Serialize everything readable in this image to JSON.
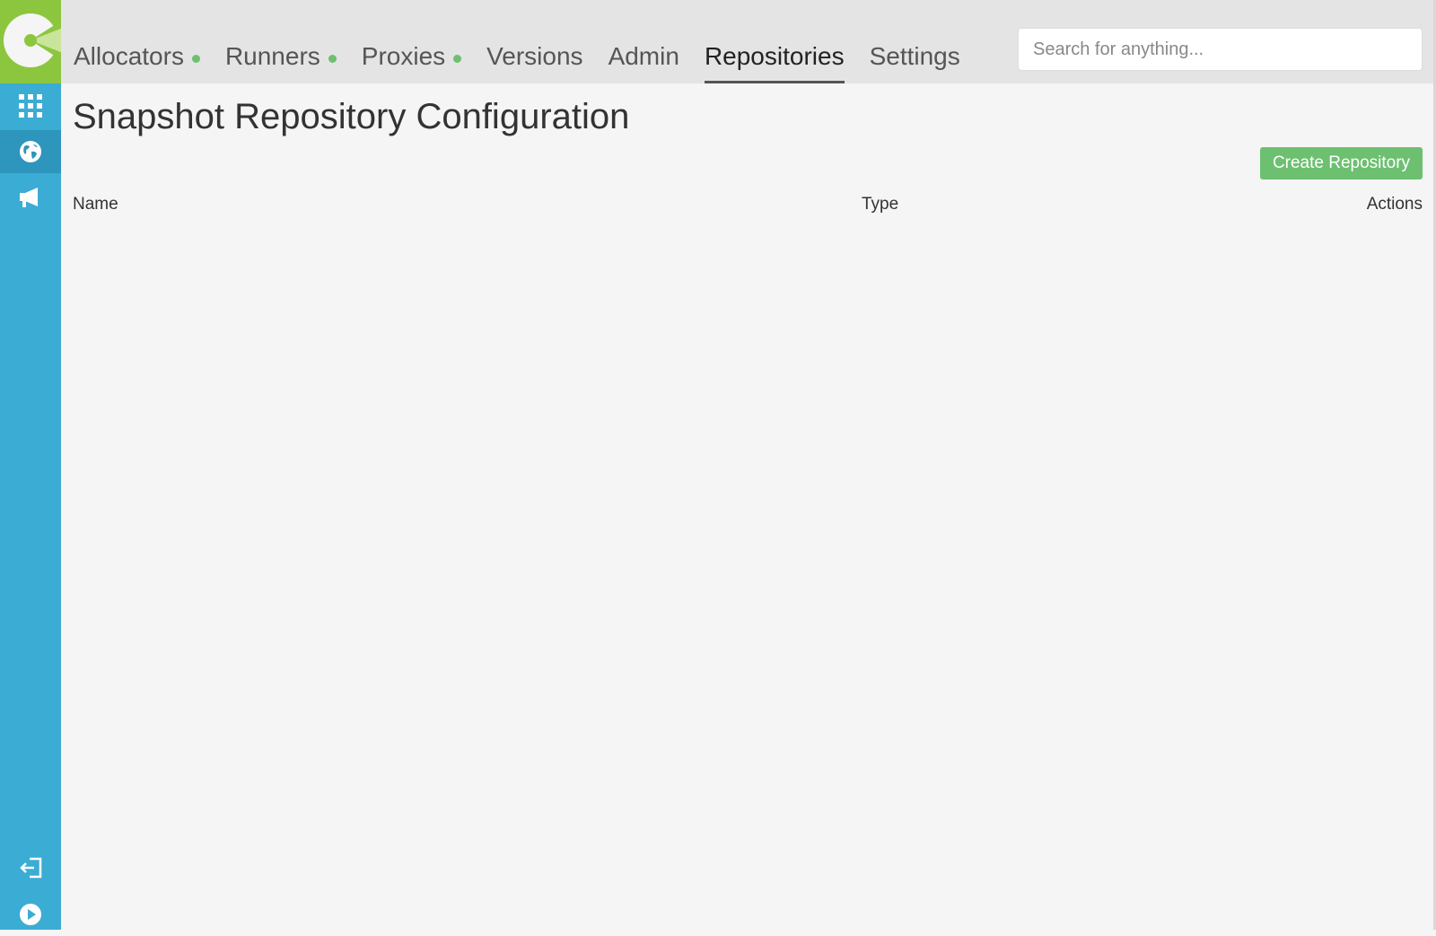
{
  "nav": {
    "tabs": [
      {
        "label": "Allocators",
        "status_dot": true
      },
      {
        "label": "Runners",
        "status_dot": true
      },
      {
        "label": "Proxies",
        "status_dot": true
      },
      {
        "label": "Versions",
        "status_dot": false
      },
      {
        "label": "Admin",
        "status_dot": false
      },
      {
        "label": "Repositories",
        "status_dot": false,
        "active": true
      },
      {
        "label": "Settings",
        "status_dot": false
      }
    ]
  },
  "search": {
    "placeholder": "Search for anything...",
    "value": ""
  },
  "sidebar": {
    "icons": [
      "apps-grid-icon",
      "globe-icon",
      "megaphone-icon",
      "logout-icon",
      "play-icon"
    ],
    "active_icon": "globe-icon"
  },
  "main": {
    "title": "Snapshot Repository Configuration",
    "create_button": "Create Repository",
    "columns": {
      "name": "Name",
      "type": "Type",
      "actions": "Actions"
    }
  },
  "colors": {
    "sidebar": "#3bacd3",
    "logo_bg": "#8cc63f",
    "status_dot": "#6cc070",
    "button": "#6cc070",
    "topbar": "#e4e4e4",
    "background": "#f5f5f5"
  }
}
